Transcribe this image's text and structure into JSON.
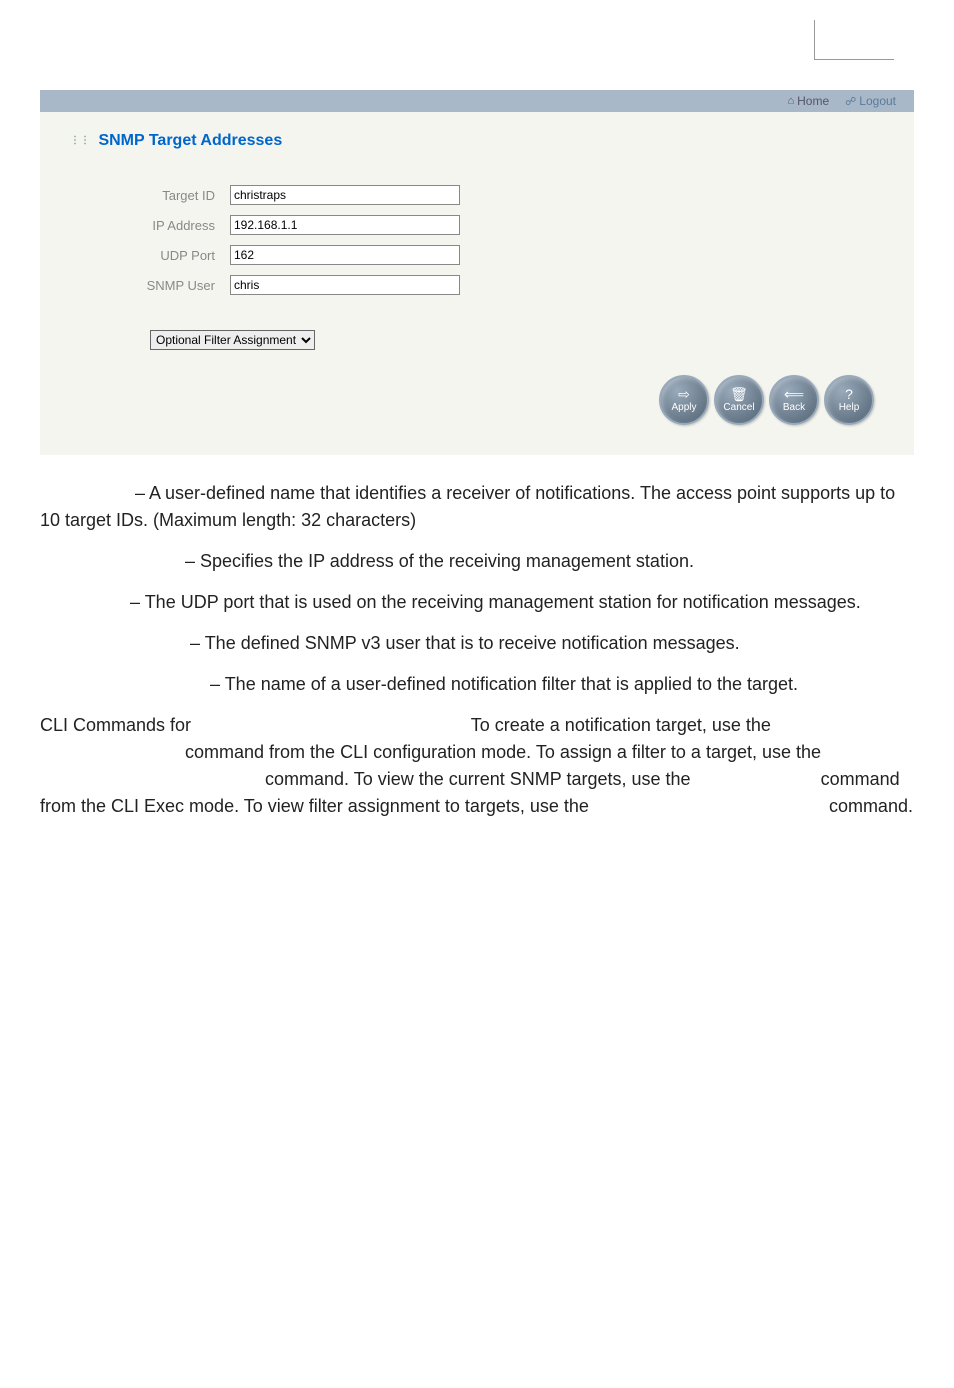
{
  "header": {
    "home_label": "Home",
    "logout_label": "Logout"
  },
  "panel": {
    "title": "SNMP Target Addresses"
  },
  "form": {
    "target_id_label": "Target ID",
    "target_id_value": "christraps",
    "ip_address_label": "IP Address",
    "ip_address_value": "192.168.1.1",
    "udp_port_label": "UDP Port",
    "udp_port_value": "162",
    "snmp_user_label": "SNMP User",
    "snmp_user_value": "chris",
    "filter_dropdown": "Optional Filter Assignment"
  },
  "buttons": {
    "apply": "Apply",
    "cancel": "Cancel",
    "back": "Back",
    "help": "Help"
  },
  "doc": {
    "p1": " – A user-defined name that identifies a receiver of notifications. The access point supports up to 10 target IDs. (Maximum length: 32 characters)",
    "p2": " – Specifies the IP address of the receiving management station.",
    "p3": " – The UDP port that is used on the receiving management station for notification messages.",
    "p4": " – The defined SNMP v3 user that is to receive notification messages.",
    "p5": " – The name of a user-defined notification filter that is applied to the target.",
    "p6a": "CLI Commands for ",
    "p6b": " To create a notification target, use the ",
    "p6c": " command from the CLI configuration mode. To assign a filter to a target, use the ",
    "p6d": " command. To view the current SNMP targets, use the ",
    "p6e": " command from the CLI Exec mode. To view filter assignment to targets, use the ",
    "p6f": " command."
  }
}
